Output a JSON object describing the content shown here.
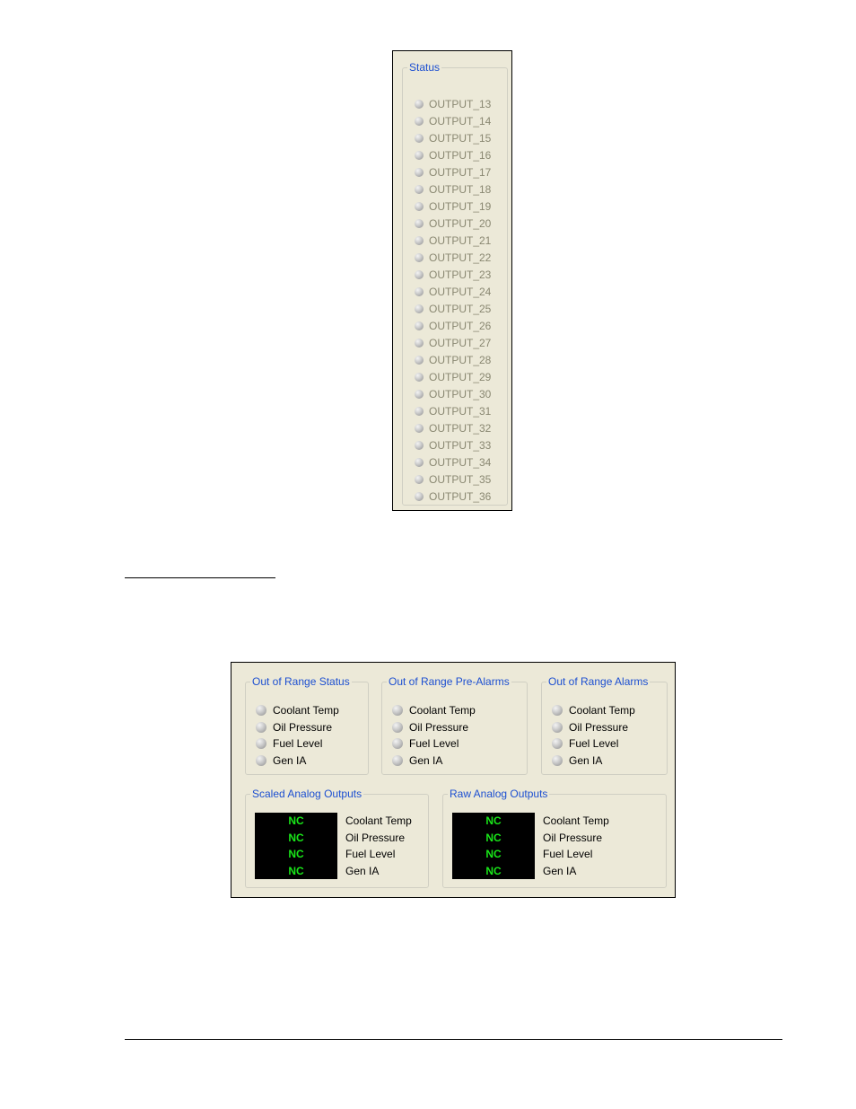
{
  "status_panel": {
    "title": "Status",
    "outputs": [
      "OUTPUT_13",
      "OUTPUT_14",
      "OUTPUT_15",
      "OUTPUT_16",
      "OUTPUT_17",
      "OUTPUT_18",
      "OUTPUT_19",
      "OUTPUT_20",
      "OUTPUT_21",
      "OUTPUT_22",
      "OUTPUT_23",
      "OUTPUT_24",
      "OUTPUT_25",
      "OUTPUT_26",
      "OUTPUT_27",
      "OUTPUT_28",
      "OUTPUT_29",
      "OUTPUT_30",
      "OUTPUT_31",
      "OUTPUT_32",
      "OUTPUT_33",
      "OUTPUT_34",
      "OUTPUT_35",
      "OUTPUT_36"
    ]
  },
  "analog_panel": {
    "out_of_range_status": {
      "title": "Out of Range Status",
      "items": [
        "Coolant Temp",
        "Oil Pressure",
        "Fuel Level",
        "Gen IA"
      ]
    },
    "out_of_range_pre_alarms": {
      "title": "Out of Range Pre-Alarms",
      "items": [
        "Coolant Temp",
        "Oil Pressure",
        "Fuel Level",
        "Gen IA"
      ]
    },
    "out_of_range_alarms": {
      "title": "Out of Range Alarms",
      "items": [
        "Coolant Temp",
        "Oil Pressure",
        "Fuel Level",
        "Gen IA"
      ]
    },
    "scaled_analog_outputs": {
      "title": "Scaled Analog Outputs",
      "values": [
        "NC",
        "NC",
        "NC",
        "NC"
      ],
      "labels": [
        "Coolant Temp",
        "Oil Pressure",
        "Fuel Level",
        "Gen IA"
      ]
    },
    "raw_analog_outputs": {
      "title": "Raw Analog Outputs",
      "values": [
        "NC",
        "NC",
        "NC",
        "NC"
      ],
      "labels": [
        "Coolant Temp",
        "Oil Pressure",
        "Fuel Level",
        "Gen IA"
      ]
    }
  },
  "colors": {
    "panel_background": "#ece9d8",
    "group_title": "#1c4fd1",
    "led_off": "#b5b5b5",
    "display_background": "#000000",
    "display_text": "#19e619",
    "inactive_text": "#8a8872"
  }
}
